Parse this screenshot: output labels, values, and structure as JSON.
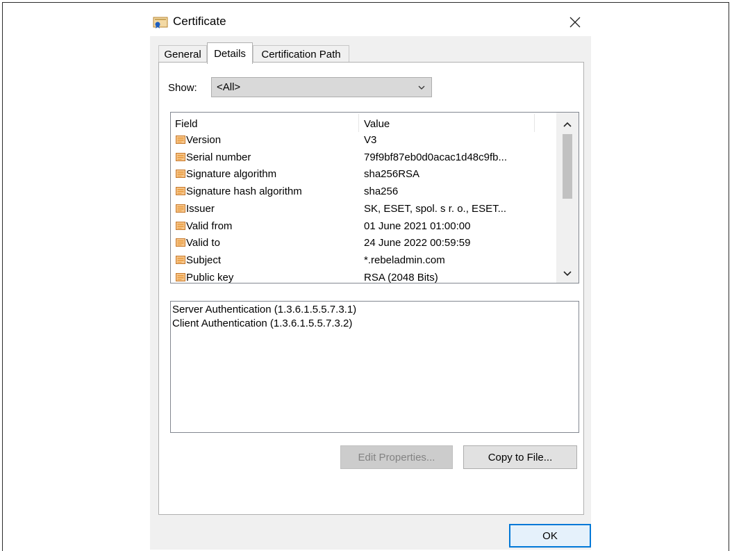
{
  "window": {
    "title": "Certificate"
  },
  "tabs": [
    {
      "label": "General",
      "active": false
    },
    {
      "label": "Details",
      "active": true
    },
    {
      "label": "Certification Path",
      "active": false
    }
  ],
  "show": {
    "label": "Show:",
    "selected": "<All>"
  },
  "fields_table": {
    "columns": [
      "Field",
      "Value"
    ],
    "rows": [
      {
        "field": "Version",
        "value": "V3"
      },
      {
        "field": "Serial number",
        "value": "79f9bf87eb0d0acac1d48c9fb..."
      },
      {
        "field": "Signature algorithm",
        "value": "sha256RSA"
      },
      {
        "field": "Signature hash algorithm",
        "value": "sha256"
      },
      {
        "field": "Issuer",
        "value": "SK, ESET, spol. s r. o., ESET..."
      },
      {
        "field": "Valid from",
        "value": "01 June 2021 01:00:00"
      },
      {
        "field": "Valid to",
        "value": "24 June 2022 00:59:59"
      },
      {
        "field": "Subject",
        "value": "*.rebeladmin.com"
      },
      {
        "field": "Public key",
        "value": "RSA (2048 Bits)"
      }
    ],
    "row_icon": "certificate-field-icon"
  },
  "value_box": {
    "lines": [
      "Server Authentication (1.3.6.1.5.5.7.3.1)",
      "Client Authentication (1.3.6.1.5.5.7.3.2)"
    ]
  },
  "buttons": {
    "edit_properties": "Edit Properties...",
    "copy_to_file": "Copy to File...",
    "ok": "OK"
  },
  "colors": {
    "ok_border": "#0078d7",
    "window_bg": "#f0f0f0",
    "row_icon_orange": "#e89a3c"
  }
}
